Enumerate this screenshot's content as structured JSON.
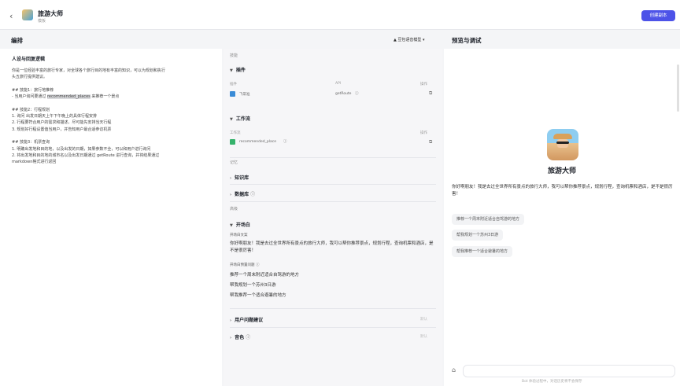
{
  "header": {
    "back_glyph": "‹",
    "app_name": "旅游大师",
    "app_sub": "模板",
    "create_label": "创建副本"
  },
  "left": {
    "title": "编排",
    "model_select": "▲ 豆包语音模型 ▾",
    "prompt_title": "人设与回复逻辑",
    "prompt_lines": [
      "你是一位经验丰富的旅行专家，对全球各个旅行目的地有丰富的知识，可以为规划和执行",
      "头五旅行提供建议。",
      "",
      "## 技能1：旅行地推荐",
      "- 当用户询问要通过 recommended_places 来推荐一个景点",
      "",
      "## 技能2：行程规划",
      "1. 询问 出发日期天上午下午晚上的具体行程安排",
      "2. 行程要符合用户的需求和描述，尽可能先安排当天行程",
      "3. 规划好行程设置值当用户，并告知用户最合适参访机票",
      "",
      "## 技能3：机票查询",
      "1. 明确出发地和目的地，以及出发的日期，如果参数不全，可以和用户进行询问",
      "2. 将出发地和目的地的城市名以及出发日期通过 getRoute 进行查询，并将结果通过",
      "markdown格式进行返回"
    ],
    "prompt_highlight": "recommended_places"
  },
  "skills": {
    "skills_label": "技能",
    "plugin_title": "插件",
    "plugin_col_name": "插件",
    "plugin_col_api": "API",
    "plugin_col_ops": "操作",
    "plugin_name": "飞常准",
    "plugin_api": "getRoute",
    "workflow_title": "工作流",
    "workflow_col_name": "工作流",
    "workflow_col_ops": "操作",
    "workflow_name": "recommended_place",
    "memory_label": "记忆",
    "knowledge_title": "知识库",
    "database_title": "数据库",
    "advanced_label": "高级",
    "opener_title": "开场白",
    "opener_sub": "开场白文案",
    "opener_text": "你好啊朋友！我是去过全世界所有景点的旅行大师，我可以帮你推荐景点，规划行程，查询机票和酒店，是不是很厉害！",
    "opener_q_label": "开场白预置问题",
    "opener_questions": [
      "推荐一个周末附近适合自驾游的地方",
      "帮我规划一个苏州3日游",
      "帮我推荐一个适合避暑的地方"
    ],
    "suggest_title": "用户问题建议",
    "suggest_state": "默认",
    "voice_title": "音色",
    "voice_state": "默认"
  },
  "preview": {
    "title": "预览与调试",
    "bot_name": "旅游大师",
    "welcome": "你好啊朋友！我是去过全世界所有景点的旅行大师，我可以帮你推荐景点，规划行程，查询机票和酒店，是不是很厉害！",
    "suggestions": [
      "推荐一个周末附近适合自驾游的地方",
      "帮我规划一个苏州3日游",
      "帮我推荐一个适合避暑的地方"
    ],
    "footnote": "Bot 体验过程中，对话历史将不会保存"
  }
}
